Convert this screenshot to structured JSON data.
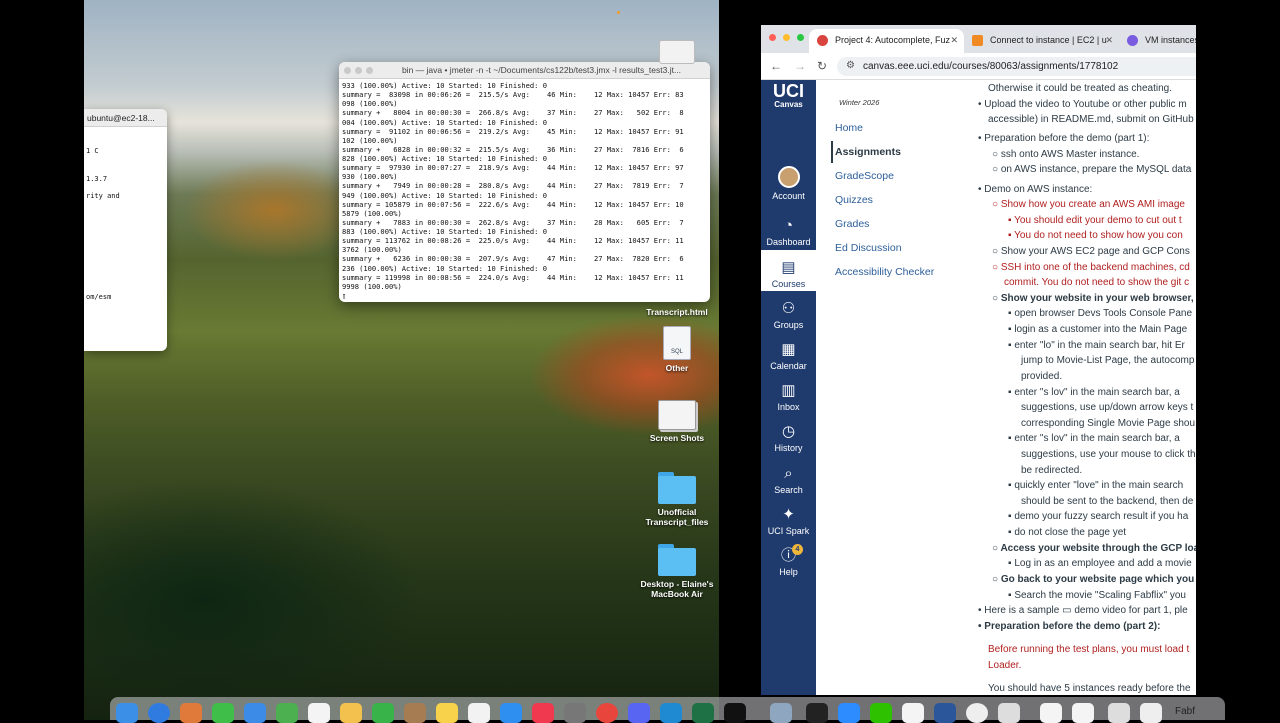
{
  "terminal": {
    "title": "bin — java • jmeter -n -t ~/Documents/cs122b/test3.jmx -l results_test3.jt...",
    "lines": [
      "933 (100.00%) Active: 10 Started: 10 Finished: 0",
      "summary =  83098 in 00:06:26 =  215.5/s Avg:    46 Min:    12 Max: 10457 Err: 83",
      "098 (100.00%)",
      "summary +   8004 in 00:00:30 =  266.8/s Avg:    37 Min:    27 Max:   502 Err:  8",
      "004 (100.00%) Active: 10 Started: 10 Finished: 0",
      "summary =  91102 in 00:06:56 =  219.2/s Avg:    45 Min:    12 Max: 10457 Err: 91",
      "102 (100.00%)",
      "summary +   6828 in 00:00:32 =  215.5/s Avg:    36 Min:    27 Max:  7816 Err:  6",
      "828 (100.00%) Active: 10 Started: 10 Finished: 0",
      "summary =  97930 in 00:07:27 =  218.9/s Avg:    44 Min:    12 Max: 10457 Err: 97",
      "930 (100.00%)",
      "summary +   7949 in 00:00:28 =  280.8/s Avg:    44 Min:    27 Max:  7819 Err:  7",
      "949 (100.00%) Active: 10 Started: 10 Finished: 0",
      "summary = 105879 in 00:07:56 =  222.6/s Avg:    44 Min:    12 Max: 10457 Err: 10",
      "5879 (100.00%)",
      "summary +   7883 in 00:00:30 =  262.8/s Avg:    37 Min:    28 Max:   605 Err:  7",
      "883 (100.00%) Active: 10 Started: 10 Finished: 0",
      "summary = 113762 in 00:08:26 =  225.0/s Avg:    44 Min:    12 Max: 10457 Err: 11",
      "3762 (100.00%)",
      "summary +   6236 in 00:00:30 =  207.9/s Avg:    47 Min:    27 Max:  7820 Err:  6",
      "236 (100.00%) Active: 10 Started: 10 Finished: 0",
      "summary = 119998 in 00:08:56 =  224.0/s Avg:    44 Min:    12 Max: 10457 Err: 11",
      "9998 (100.00%)",
      "▯"
    ]
  },
  "ubuntu": {
    "title": "ubuntu@ec2-18...",
    "lines": [
      "1 C",
      "1.3.7",
      "rity and",
      "om/esm"
    ]
  },
  "desktop": {
    "items": [
      "Transcript.html",
      "Other",
      "Screen Shots",
      "Unofficial Transcript_files",
      "Desktop - Elaine's MacBook Air"
    ]
  },
  "browser": {
    "tabs": [
      {
        "label": "Project 4: Autocomplete, Fuz",
        "color": "#d9443f"
      },
      {
        "label": "Connect to instance | EC2 | u",
        "color": "#f08a24"
      },
      {
        "label": "VM instances –",
        "color": "#7a5ce0"
      }
    ],
    "url": "canvas.eee.uci.edu/courses/80063/assignments/1778102",
    "logo": "UCI",
    "logo_sub": "Canvas",
    "global_nav": [
      "Account",
      "Dashboard",
      "Courses",
      "Groups",
      "Calendar",
      "Inbox",
      "History",
      "Search",
      "UCI Spark",
      "Help"
    ],
    "help_badge": "4",
    "term": "Winter 2026",
    "course_nav": [
      "Home",
      "Assignments",
      "GradeScope",
      "Quizzes",
      "Grades",
      "Ed Discussion",
      "Accessibility Checker"
    ]
  },
  "content": {
    "lines": [
      "Otherwise it could be treated as cheating.",
      "Upload the video to Youtube or other public m",
      "accessible) in README.md, submit on GitHub",
      "Preparation before the demo (part 1):",
      "ssh onto AWS Master instance.",
      "on AWS instance, prepare the MySQL data",
      "Demo on AWS instance:",
      "Show how you create an AWS AMI image",
      "You should edit your demo to cut out t",
      "You do not need to show how you con",
      "Show your AWS EC2 page and GCP Cons",
      "SSH into one of the backend machines, cd",
      "commit. You do not need to show the git c",
      "Show your website in your web browser, a",
      "open browser Devs Tools Console Pane",
      "login as a customer into the Main Page",
      "enter \"lo\" in the main search bar, hit Er",
      "jump to Movie-List Page, the autocomp",
      "provided.",
      "enter \"s lov\" in the main search bar,  a",
      "suggestions, use up/down arrow keys t",
      "corresponding Single Movie Page shou",
      "enter \"s lov\" in the main search bar,  a",
      "suggestions, use your mouse to click th",
      "be redirected.",
      "quickly enter \"love\" in the main search",
      "should be sent to the backend, then de",
      "demo your fuzzy search result if you ha",
      "do not close the page yet",
      "Access your website through the GCP loa",
      "Log in as an employee and add a movie",
      "Go back to your website page which you c",
      "Search the movie \"Scaling Fabflix\" you",
      "Here is a sample ▭ demo video for part 1, ple",
      "Preparation before the demo (part 2):",
      "Before running the test plans, you must load t",
      "Loader.",
      "You should have 5 instances ready before the"
    ]
  },
  "dock_right_text": "Fabf"
}
